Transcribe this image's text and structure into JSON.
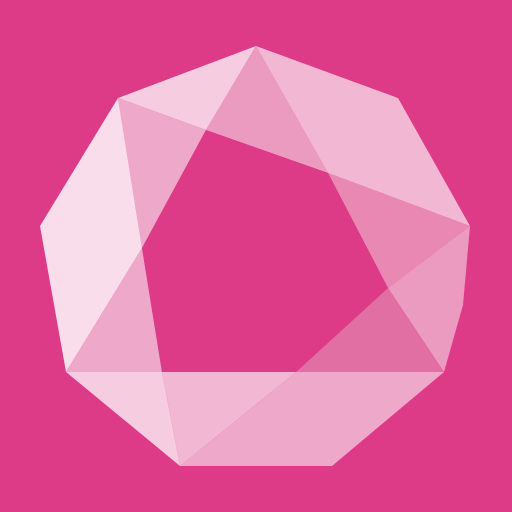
{
  "icon": {
    "name": "crystal-gem-icon",
    "colors": {
      "background": "#DD3A87",
      "window": "#DD3A87",
      "facet_lightest": "#F9DDEA",
      "facet_light": "#F6CCE0",
      "facet_mid_light": "#F2B7D3",
      "facet_mid": "#EEA8C9",
      "facet_medium": "#EC9BC0",
      "facet_deep": "#E888B3",
      "facet_deeper": "#E26FA3"
    }
  }
}
